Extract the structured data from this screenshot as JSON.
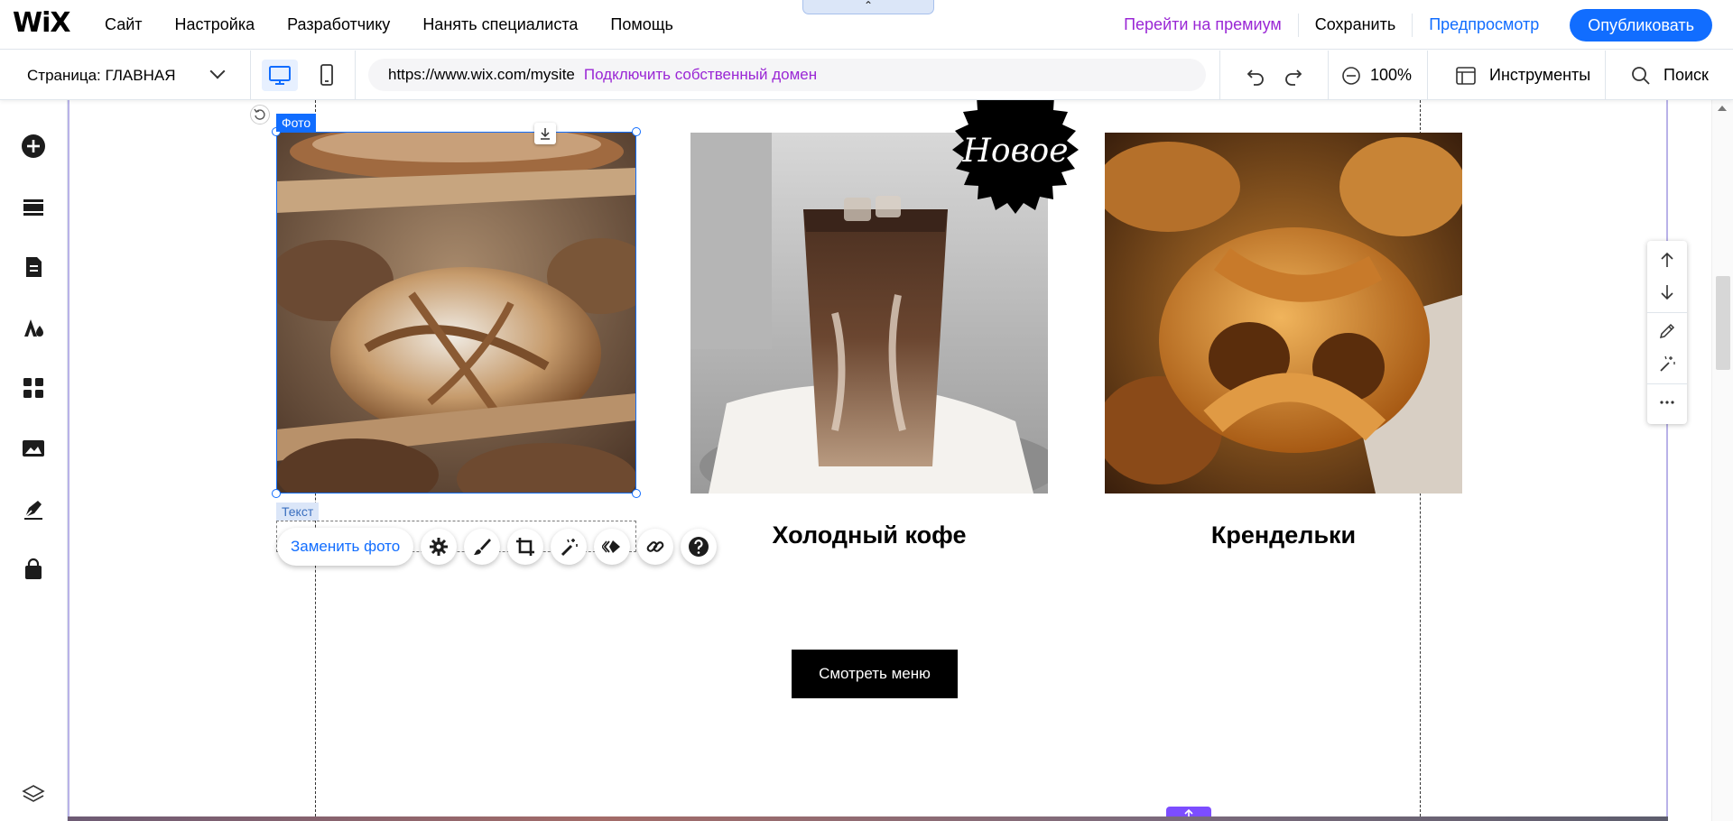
{
  "app": {
    "logo": "WiX"
  },
  "top_menu": [
    "Сайт",
    "Настройка",
    "Разработчику",
    "Нанять специалиста",
    "Помощь"
  ],
  "top_right": {
    "premium": "Перейти на премиум",
    "save": "Сохранить",
    "preview": "Предпросмотр",
    "publish": "Опубликовать"
  },
  "collapse_glyph": "⌃",
  "subbar": {
    "page_label": "Страница: ГЛАВНАЯ",
    "url": "https://www.wix.com/mysite",
    "connect_domain": "Подключить собственный домен",
    "zoom": "100%",
    "tools": "Инструменты",
    "search": "Поиск"
  },
  "canvas": {
    "tag_photo": "Фото",
    "tag_text": "Текст",
    "items": [
      {
        "caption": "",
        "image": "bread-loaves"
      },
      {
        "caption": "Холодный кофе",
        "image": "iced-coffee"
      },
      {
        "caption": "Крендельки",
        "image": "pretzels"
      }
    ],
    "new_badge": "Новое",
    "menu_button": "Смотреть меню"
  },
  "image_toolbar": {
    "replace": "Заменить фото",
    "icons": [
      "gear-icon",
      "brush-icon",
      "crop-icon",
      "magic-wand-icon",
      "animation-icon",
      "link-icon",
      "help-icon"
    ]
  },
  "sidebar_icons": [
    "add-icon",
    "sections-icon",
    "pages-icon",
    "design-icon",
    "apps-icon",
    "media-icon",
    "blog-icon",
    "store-icon",
    "layers-icon"
  ],
  "right_panel_icons": [
    "arrow-up-icon",
    "arrow-down-icon",
    "pencil-icon",
    "magic-icon",
    "more-icon"
  ],
  "colors": {
    "accent": "#116dff",
    "premium": "#9a27d5",
    "frame": "#b9b2e8"
  }
}
